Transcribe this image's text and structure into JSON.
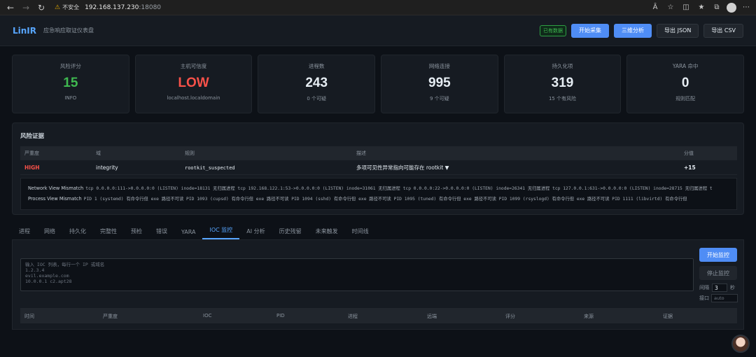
{
  "browser": {
    "insecure_label": "不安全",
    "url_host": "192.168.137.230",
    "url_port": ":18080"
  },
  "header": {
    "logo": "LinIR",
    "subtitle": "应急响应取证仪表盘",
    "data_badge": "已有数据",
    "start_collect": "开始采集",
    "three_dim": "三维分析",
    "export_json": "导出 JSON",
    "export_csv": "导出 CSV"
  },
  "cards": [
    {
      "label": "风险评分",
      "value": "15",
      "sub": "INFO",
      "color": "#3fb950"
    },
    {
      "label": "主机可信度",
      "value": "LOW",
      "sub": "localhost.localdomain",
      "color": "#f85149"
    },
    {
      "label": "进程数",
      "value": "243",
      "sub": "0 个可疑",
      "color": "#e6edf3"
    },
    {
      "label": "网络连接",
      "value": "995",
      "sub": "9 个可疑",
      "color": "#e6edf3"
    },
    {
      "label": "持久化项",
      "value": "319",
      "sub": "15 个有风险",
      "color": "#e6edf3"
    },
    {
      "label": "YARA 命中",
      "value": "0",
      "sub": "规则匹配",
      "color": "#e6edf3"
    }
  ],
  "risk": {
    "title": "风险证据",
    "headers": {
      "severity": "严重度",
      "domain": "域",
      "rule": "规则",
      "description": "描述",
      "score": "分值"
    },
    "row": {
      "severity": "HIGH",
      "domain": "integrity",
      "rule": "rootkit_suspected",
      "description": "多项可见性异常指向可能存在 rootkit ▼",
      "score": "+15"
    },
    "evidence": [
      {
        "label": "Network View Mismatch",
        "text": "tcp 0.0.0.0:111->0.0.0.0:0 (LISTEN) inode=18131 无归属进程  tcp 192.168.122.1:53->0.0.0.0:0 (LISTEN) inode=31061 无归属进程  tcp 0.0.0.0:22->0.0.0.0:0 (LISTEN) inode=26341 无归属进程  tcp 127.0.0.1:631->0.0.0.0:0 (LISTEN) inode=28715 无归属进程  t"
      },
      {
        "label": "Process View Mismatch",
        "text": "PID 1 (systemd) 有命令行但 exe 路径不可读  PID 1093 (cupsd) 有命令行但 exe 路径不可读  PID 1094 (sshd) 有命令行但 exe 路径不可读  PID 1095 (tuned) 有命令行但 exe 路径不可读  PID 1099 (rsyslogd) 有命令行但 exe 路径不可读  PID 1111 (libvirtd) 有命令行但"
      }
    ]
  },
  "tabs": [
    {
      "label": "进程",
      "active": false
    },
    {
      "label": "网络",
      "active": false
    },
    {
      "label": "持久化",
      "active": false
    },
    {
      "label": "完整性",
      "active": false
    },
    {
      "label": "预检",
      "active": false
    },
    {
      "label": "错误",
      "active": false
    },
    {
      "label": "YARA",
      "active": false
    },
    {
      "label": "IOC 监控",
      "active": true
    },
    {
      "label": "AI 分析",
      "active": false
    },
    {
      "label": "历史残留",
      "active": false
    },
    {
      "label": "未来触发",
      "active": false
    },
    {
      "label": "时间线",
      "active": false
    }
  ],
  "ioc": {
    "placeholder": "输入 IOC 列表，每行一个 IP 或域名\n1.2.3.4\nevil.example.com\n10.0.0.1 c2.apt28",
    "start_monitor": "开始监控",
    "stop_monitor": "停止监控",
    "interval_label": "间隔",
    "interval_value": "3",
    "interval_unit": "秒",
    "port_label": "接口",
    "port_placeholder": "auto",
    "table_headers": [
      "时间",
      "严重度",
      "IOC",
      "PID",
      "进程",
      "远端",
      "评分",
      "来源",
      "证据"
    ]
  }
}
